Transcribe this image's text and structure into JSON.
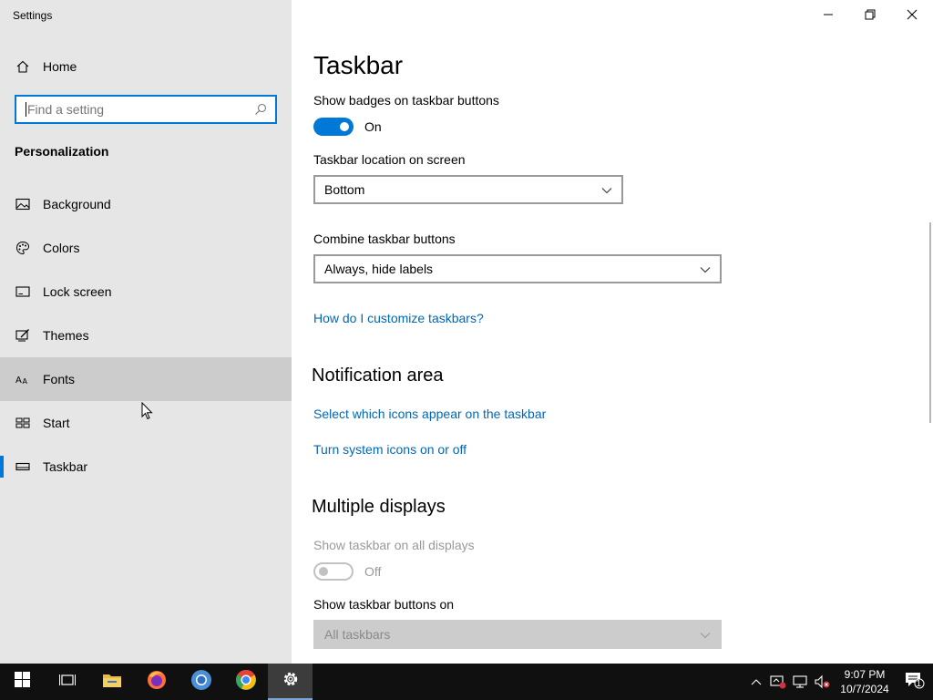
{
  "window": {
    "title": "Settings",
    "controls": [
      "minimize",
      "restore",
      "close"
    ]
  },
  "sidebar": {
    "home_label": "Home",
    "search_placeholder": "Find a setting",
    "section_title": "Personalization",
    "items": [
      {
        "label": "Background",
        "icon": "picture-icon"
      },
      {
        "label": "Colors",
        "icon": "palette-icon"
      },
      {
        "label": "Lock screen",
        "icon": "lock-screen-icon"
      },
      {
        "label": "Themes",
        "icon": "themes-icon"
      },
      {
        "label": "Fonts",
        "icon": "fonts-icon"
      },
      {
        "label": "Start",
        "icon": "start-icon"
      },
      {
        "label": "Taskbar",
        "icon": "taskbar-icon"
      }
    ],
    "active_item": "Taskbar",
    "hovered_item": "Fonts"
  },
  "main": {
    "page_title": "Taskbar",
    "badges_label": "Show badges on taskbar buttons",
    "badges_state": "On",
    "location_label": "Taskbar location on screen",
    "location_value": "Bottom",
    "combine_label": "Combine taskbar buttons",
    "combine_value": "Always, hide labels",
    "customize_link": "How do I customize taskbars?",
    "notification_heading": "Notification area",
    "select_icons_link": "Select which icons appear on the taskbar",
    "system_icons_link": "Turn system icons on or off",
    "multiple_heading": "Multiple displays",
    "all_displays_label": "Show taskbar on all displays",
    "all_displays_state": "Off",
    "buttons_on_label": "Show taskbar buttons on",
    "buttons_on_value": "All taskbars"
  },
  "taskbar": {
    "apps": [
      "start-icon",
      "task-view-icon",
      "file-explorer-icon",
      "firefox-icon",
      "chrome-icon",
      "chrome-canary-icon",
      "settings-icon"
    ],
    "time": "9:07 PM",
    "date": "10/7/2024",
    "notification_count": "1"
  },
  "colors": {
    "accent": "#0078d7",
    "link": "#0067b8",
    "sidebar_bg": "#e6e6e6",
    "hover_bg": "#cccccc",
    "taskbar_bg": "#101010"
  }
}
